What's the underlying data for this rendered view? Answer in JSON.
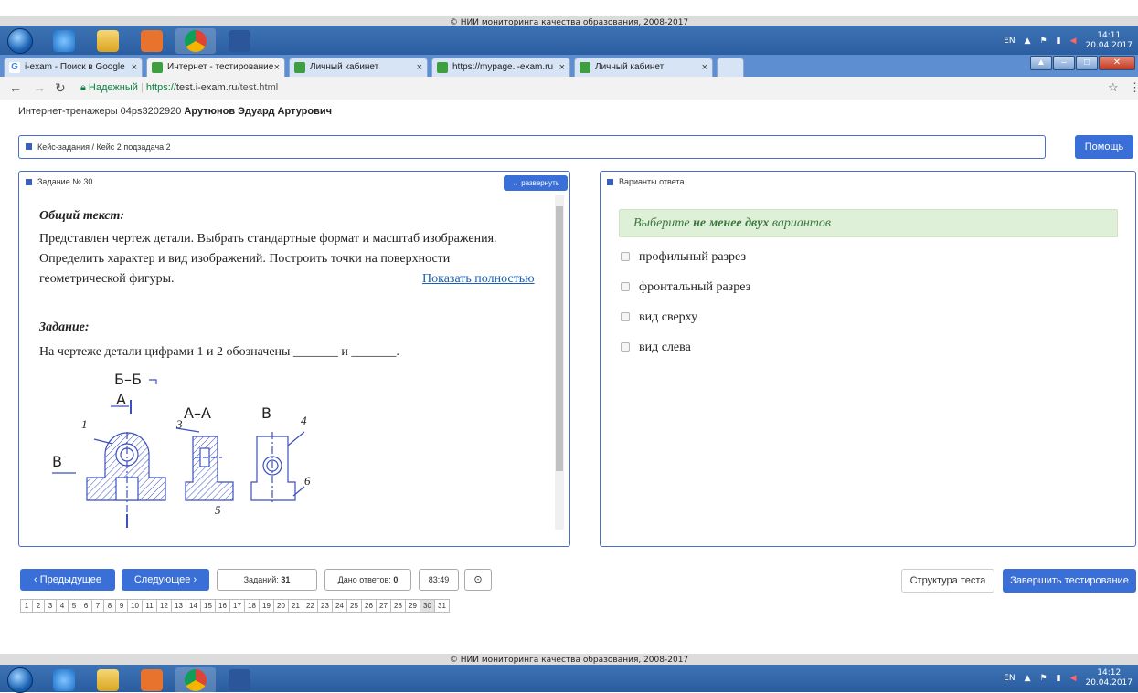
{
  "top_bar": {
    "copyright": "© НИИ мониторинга качества образования, 2008-2017"
  },
  "taskbar_top": {
    "lang": "EN",
    "time": "14:11",
    "date": "20.04.2017"
  },
  "browser": {
    "tabs": [
      {
        "label": "i-exam - Поиск в Google",
        "fav": "G"
      },
      {
        "label": "Интернет - тестирование",
        "fav": ""
      },
      {
        "label": "Личный кабинет",
        "fav": ""
      },
      {
        "label": "https://mypage.i-exam.ru",
        "fav": ""
      },
      {
        "label": "Личный кабинет",
        "fav": ""
      }
    ],
    "secure_label": "Надежный",
    "url_prefix": "https://",
    "url_host": "test.i-exam.ru",
    "url_path": "/test.html"
  },
  "user_line": {
    "prefix": "Интернет-тренажеры 04ps3202920",
    "name": "Арутюнов Эдуард Артурович"
  },
  "breadcrumb": "Кейс-задания / Кейс 2 подзадача 2",
  "help_label": "Помощь",
  "task_panel": {
    "title": "Задание № 30",
    "expand_label": "↔ развернуть",
    "general_heading": "Общий текст:",
    "general_lines": [
      "Представлен чертеж детали. Выбрать стандартные формат и масштаб изображения.",
      "Определить характер и вид изображений. Построить точки на поверхности",
      "геометрической фигуры."
    ],
    "show_full_link": "Показать полностью",
    "task_heading": "Задание:",
    "task_text": "На чертеже детали цифрами 1 и 2 обозначены _______ и _______.",
    "drawing_labels": {
      "bb": "Б–Б",
      "a": "А",
      "aa": "А–А",
      "b1": "В",
      "b2": "В",
      "n1": "1",
      "n3": "3",
      "n4": "4",
      "n5": "5",
      "n6": "6"
    }
  },
  "answer_panel": {
    "title": "Варианты ответа",
    "hint_pre": "Выберите ",
    "hint_bold": "не менее двух",
    "hint_post": " вариантов",
    "options": [
      "профильный разрез",
      "фронтальный разрез",
      "вид сверху",
      "вид слева"
    ]
  },
  "nav": {
    "prev_label": "Предыдущее",
    "next_label": "Следующее",
    "tasks_label": "Заданий:",
    "tasks_count": "31",
    "answers_label": "Дано ответов:",
    "answers_count": "0",
    "timer": "83:49",
    "structure_label": "Структура теста",
    "finish_label": "Завершить тестирование",
    "pages": [
      "1",
      "2",
      "3",
      "4",
      "5",
      "6",
      "7",
      "8",
      "9",
      "10",
      "11",
      "12",
      "13",
      "14",
      "15",
      "16",
      "17",
      "18",
      "19",
      "20",
      "21",
      "22",
      "23",
      "24",
      "25",
      "26",
      "27",
      "28",
      "29",
      "30",
      "31"
    ],
    "current_page": "30"
  },
  "bottom_bar": {
    "copyright": "© НИИ мониторинга качества образования, 2008-2017"
  },
  "taskbar_bottom": {
    "lang": "EN",
    "time": "14:12",
    "date": "20.04.2017"
  },
  "colors": {
    "accent": "#3a6fd8",
    "panel_border": "#4a6fc9",
    "hint_bg": "#dff0d8",
    "hint_text": "#3c763d"
  }
}
